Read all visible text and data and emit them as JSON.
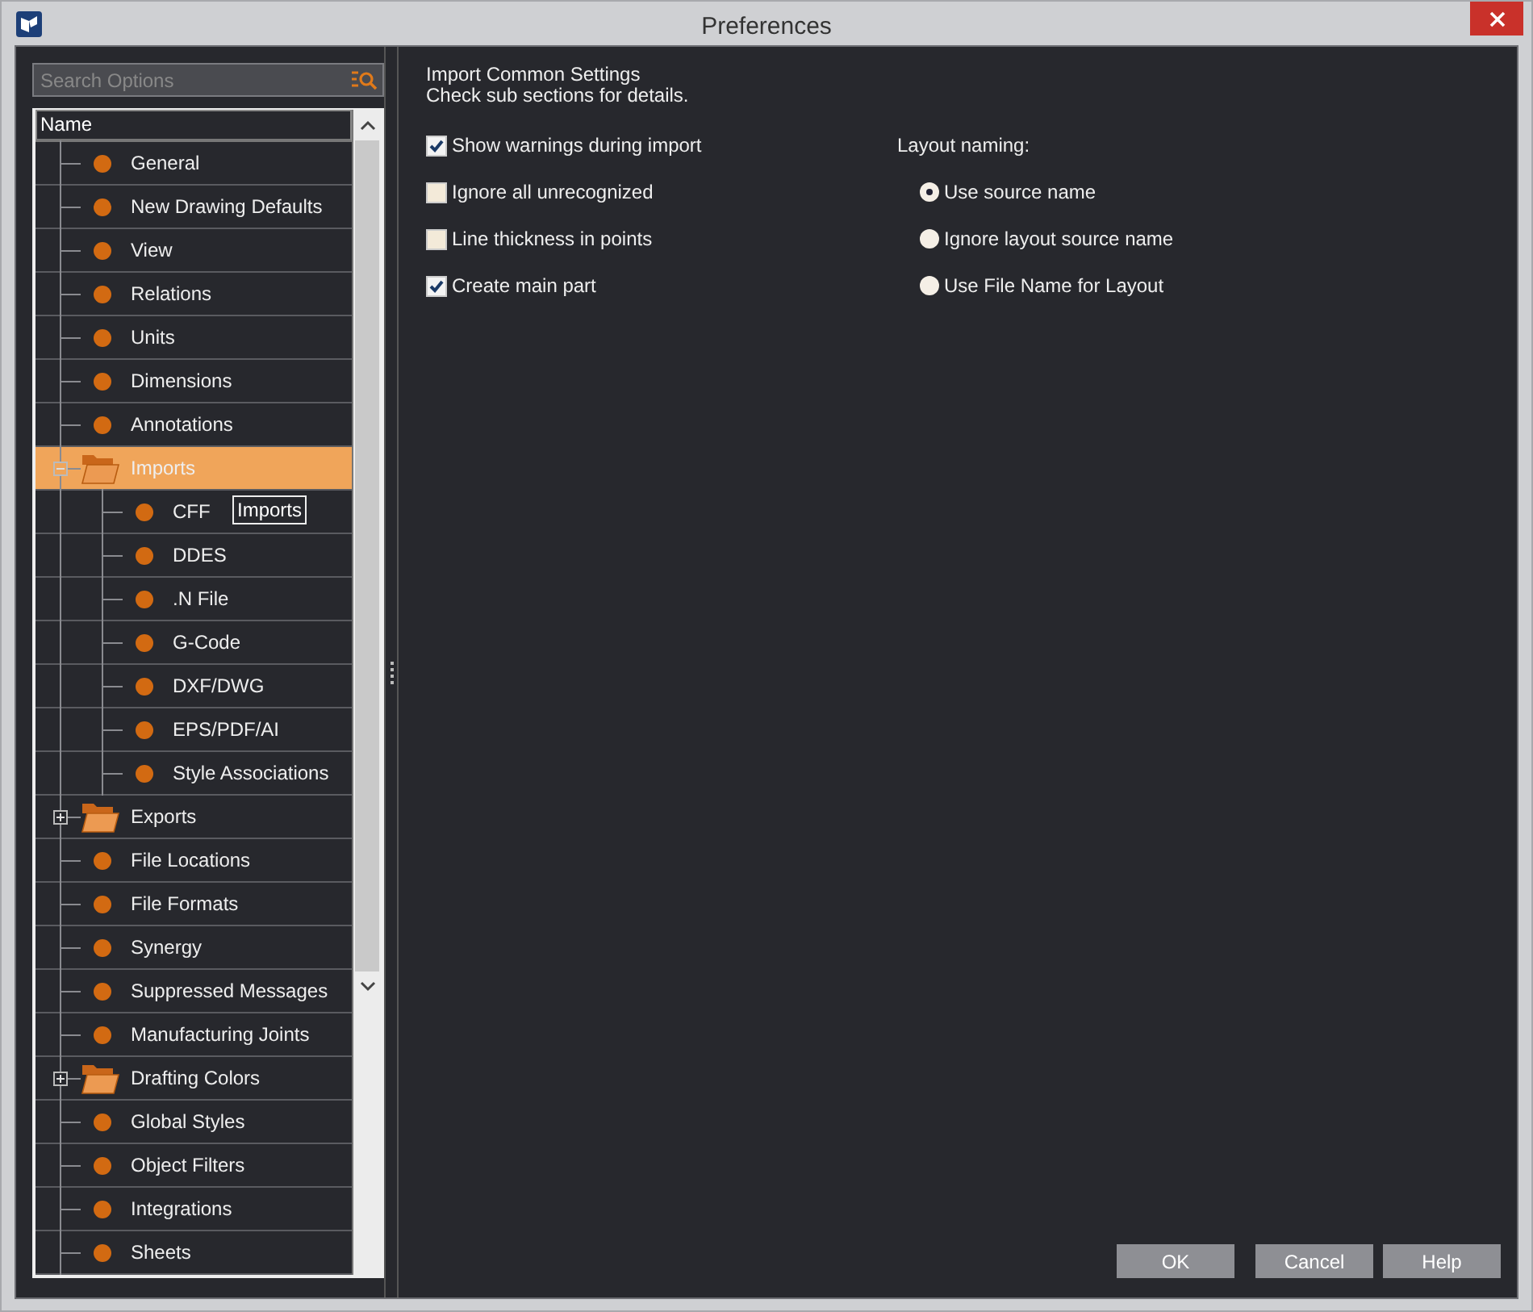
{
  "window": {
    "title": "Preferences"
  },
  "search": {
    "placeholder": "Search Options"
  },
  "tree": {
    "header": "Name",
    "items": [
      {
        "label": "General",
        "kind": "leaf",
        "selected": false
      },
      {
        "label": "New Drawing Defaults",
        "kind": "leaf",
        "selected": false
      },
      {
        "label": "View",
        "kind": "leaf",
        "selected": false
      },
      {
        "label": "Relations",
        "kind": "leaf",
        "selected": false
      },
      {
        "label": "Units",
        "kind": "leaf",
        "selected": false
      },
      {
        "label": "Dimensions",
        "kind": "leaf",
        "selected": false
      },
      {
        "label": "Annotations",
        "kind": "leaf",
        "selected": false
      },
      {
        "label": "Imports",
        "kind": "folder",
        "selected": true,
        "expanded": true,
        "children": [
          {
            "label": "CFF",
            "kind": "leaf",
            "selected": false
          },
          {
            "label": "DDES",
            "kind": "leaf",
            "selected": false
          },
          {
            "label": ".N File",
            "kind": "leaf",
            "selected": false
          },
          {
            "label": "G-Code",
            "kind": "leaf",
            "selected": false
          },
          {
            "label": "DXF/DWG",
            "kind": "leaf",
            "selected": false
          },
          {
            "label": "EPS/PDF/AI",
            "kind": "leaf",
            "selected": false
          },
          {
            "label": "Style Associations",
            "kind": "leaf",
            "selected": false
          }
        ]
      },
      {
        "label": "Exports",
        "kind": "folder",
        "selected": false,
        "expanded": false
      },
      {
        "label": "File Locations",
        "kind": "leaf",
        "selected": false
      },
      {
        "label": "File Formats",
        "kind": "leaf",
        "selected": false
      },
      {
        "label": "Synergy",
        "kind": "leaf",
        "selected": false
      },
      {
        "label": "Suppressed Messages",
        "kind": "leaf",
        "selected": false
      },
      {
        "label": "Manufacturing Joints",
        "kind": "leaf",
        "selected": false
      },
      {
        "label": "Drafting Colors",
        "kind": "folder",
        "selected": false,
        "expanded": false
      },
      {
        "label": "Global Styles",
        "kind": "leaf",
        "selected": false
      },
      {
        "label": "Object Filters",
        "kind": "leaf",
        "selected": false
      },
      {
        "label": "Integrations",
        "kind": "leaf",
        "selected": false
      },
      {
        "label": "Sheets",
        "kind": "leaf",
        "selected": false
      }
    ]
  },
  "tooltip": "Imports",
  "heading": "Import Common Settings",
  "subheading": "Check sub sections for details.",
  "options": [
    {
      "label": "Show warnings during import",
      "checked": true
    },
    {
      "label": "Ignore all unrecognized",
      "checked": false
    },
    {
      "label": "Line thickness in points",
      "checked": false
    },
    {
      "label": "Create main part",
      "checked": true
    }
  ],
  "layout_naming": {
    "label": "Layout naming:",
    "options": [
      {
        "label": "Use source name",
        "selected": true
      },
      {
        "label": "Ignore layout source name",
        "selected": false
      },
      {
        "label": "Use File Name for Layout",
        "selected": false
      }
    ]
  },
  "buttons": [
    "OK",
    "Cancel",
    "Help"
  ]
}
